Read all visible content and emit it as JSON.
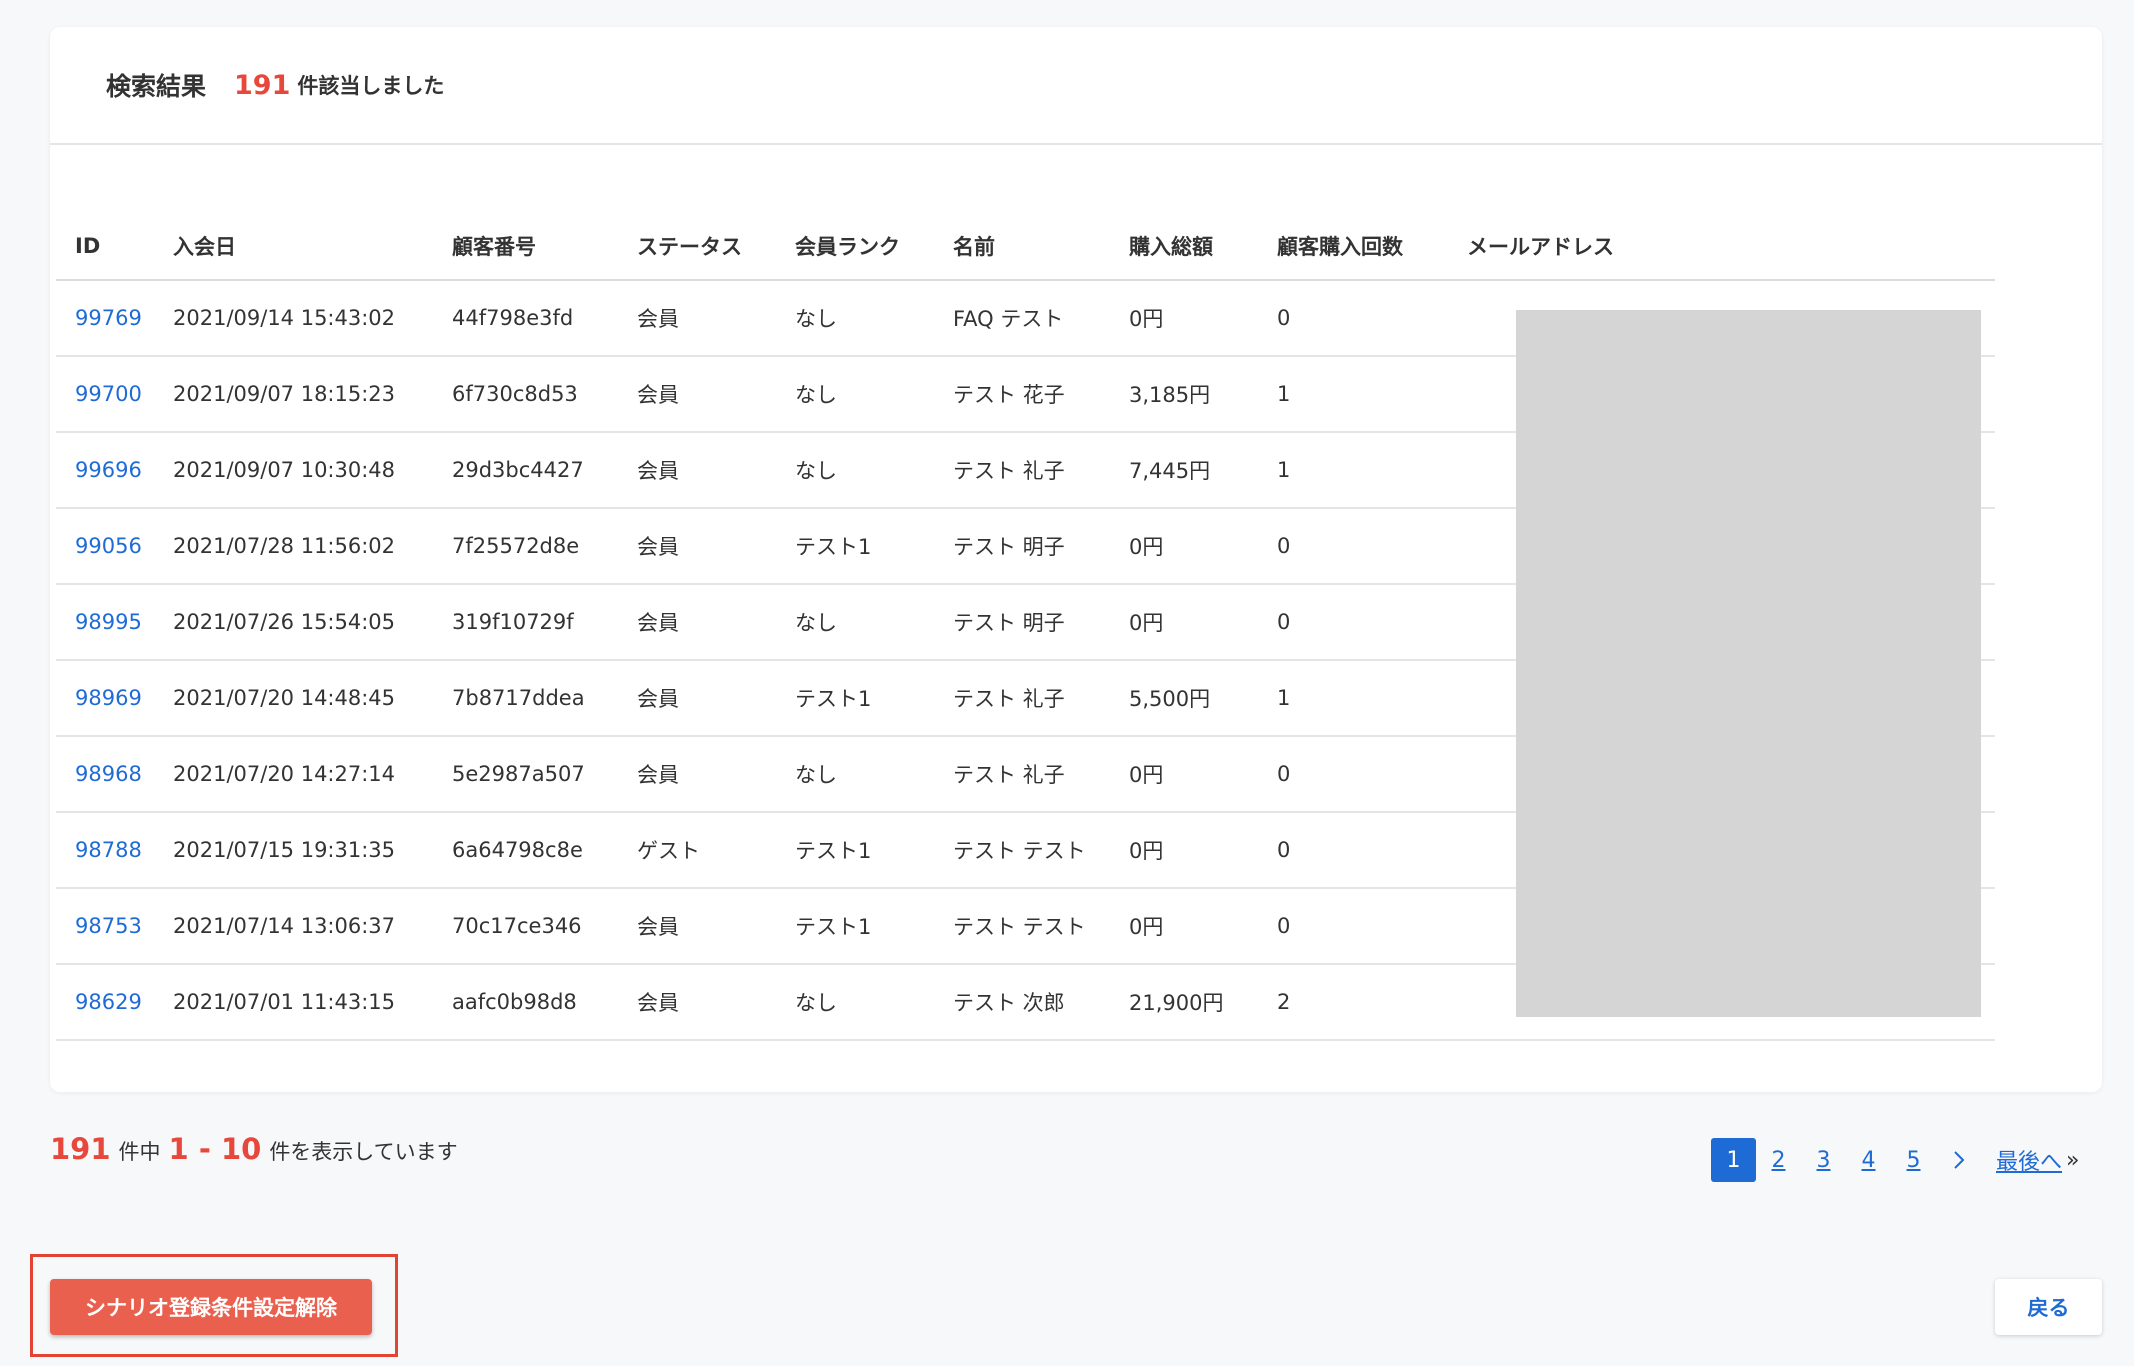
{
  "header": {
    "title": "検索結果",
    "count": "191",
    "count_suffix": "件該当しました"
  },
  "table": {
    "columns": [
      "ID",
      "入会日",
      "顧客番号",
      "ステータス",
      "会員ランク",
      "名前",
      "購入総額",
      "顧客購入回数",
      "メールアドレス"
    ],
    "rows": [
      {
        "id": "99769",
        "date": "2021/09/14 15:43:02",
        "number": "44f798e3fd",
        "status": "会員",
        "rank": "なし",
        "name": "FAQ テスト",
        "total": "0円",
        "purchases": "0"
      },
      {
        "id": "99700",
        "date": "2021/09/07 18:15:23",
        "number": "6f730c8d53",
        "status": "会員",
        "rank": "なし",
        "name": "テスト 花子",
        "total": "3,185円",
        "purchases": "1"
      },
      {
        "id": "99696",
        "date": "2021/09/07 10:30:48",
        "number": "29d3bc4427",
        "status": "会員",
        "rank": "なし",
        "name": "テスト 礼子",
        "total": "7,445円",
        "purchases": "1"
      },
      {
        "id": "99056",
        "date": "2021/07/28 11:56:02",
        "number": "7f25572d8e",
        "status": "会員",
        "rank": "テスト1",
        "name": "テスト 明子",
        "total": "0円",
        "purchases": "0"
      },
      {
        "id": "98995",
        "date": "2021/07/26 15:54:05",
        "number": "319f10729f",
        "status": "会員",
        "rank": "なし",
        "name": "テスト 明子",
        "total": "0円",
        "purchases": "0"
      },
      {
        "id": "98969",
        "date": "2021/07/20 14:48:45",
        "number": "7b8717ddea",
        "status": "会員",
        "rank": "テスト1",
        "name": "テスト 礼子",
        "total": "5,500円",
        "purchases": "1"
      },
      {
        "id": "98968",
        "date": "2021/07/20 14:27:14",
        "number": "5e2987a507",
        "status": "会員",
        "rank": "なし",
        "name": "テスト 礼子",
        "total": "0円",
        "purchases": "0"
      },
      {
        "id": "98788",
        "date": "2021/07/15 19:31:35",
        "number": "6a64798c8e",
        "status": "ゲスト",
        "rank": "テスト1",
        "name": "テスト テスト",
        "total": "0円",
        "purchases": "0"
      },
      {
        "id": "98753",
        "date": "2021/07/14 13:06:37",
        "number": "70c17ce346",
        "status": "会員",
        "rank": "テスト1",
        "name": "テスト テスト",
        "total": "0円",
        "purchases": "0"
      },
      {
        "id": "98629",
        "date": "2021/07/01 11:43:15",
        "number": "aafc0b98d8",
        "status": "会員",
        "rank": "なし",
        "name": "テスト 次郎",
        "total": "21,900円",
        "purchases": "2"
      }
    ]
  },
  "summary": {
    "total": "191",
    "text_mid": "件中",
    "range": "1 - 10",
    "text_end": "件を表示しています"
  },
  "pagination": {
    "pages": [
      "1",
      "2",
      "3",
      "4",
      "5"
    ],
    "current": "1",
    "next_icon": "chevron-right-icon",
    "last_label": "最後へ",
    "last_suffix": "»"
  },
  "actions": {
    "release_label": "シナリオ登録条件設定解除",
    "back_label": "戻る"
  },
  "colors": {
    "accent_red": "#e8473b",
    "button_red": "#e9604f",
    "link_blue": "#1f6bd6",
    "redaction": "#d5d5d5"
  }
}
